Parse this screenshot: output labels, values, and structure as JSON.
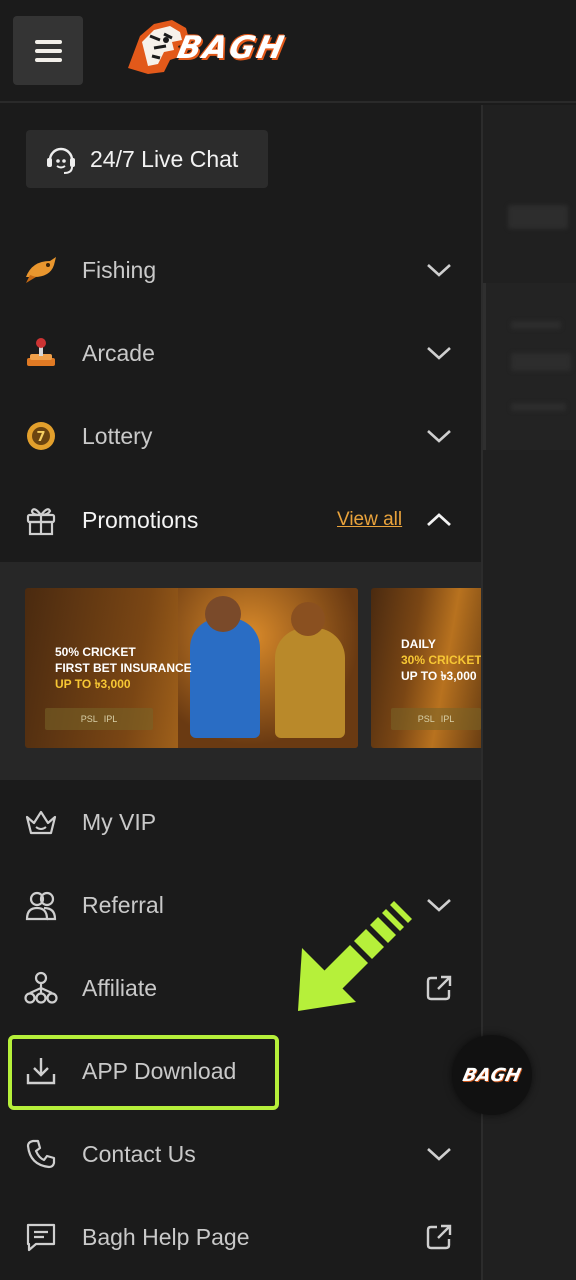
{
  "header": {
    "logo_text": "BAGH"
  },
  "live_chat": {
    "label": "24/7 Live Chat"
  },
  "menu": [
    {
      "id": "fishing",
      "label": "Fishing",
      "icon": "fishing-icon",
      "trailing": "chevron-down"
    },
    {
      "id": "arcade",
      "label": "Arcade",
      "icon": "arcade-icon",
      "trailing": "chevron-down"
    },
    {
      "id": "lottery",
      "label": "Lottery",
      "icon": "lottery-icon",
      "trailing": "chevron-down"
    },
    {
      "id": "promotions",
      "label": "Promotions",
      "icon": "gift-icon",
      "trailing": "chevron-up",
      "view_all": "View all"
    },
    {
      "id": "my-vip",
      "label": "My VIP",
      "icon": "crown-icon",
      "trailing": "none"
    },
    {
      "id": "referral",
      "label": "Referral",
      "icon": "users-icon",
      "trailing": "chevron-down"
    },
    {
      "id": "affiliate",
      "label": "Affiliate",
      "icon": "network-icon",
      "trailing": "external-link"
    },
    {
      "id": "app-download",
      "label": "APP Download",
      "icon": "download-icon",
      "trailing": "none"
    },
    {
      "id": "contact-us",
      "label": "Contact Us",
      "icon": "phone-icon",
      "trailing": "chevron-down"
    },
    {
      "id": "help-page",
      "label": "Bagh Help Page",
      "icon": "chat-icon",
      "trailing": "external-link"
    }
  ],
  "promotions": {
    "banners": [
      {
        "line1": "50% CRICKET",
        "line2": "FIRST BET INSURANCE",
        "line3": "UP TO ৳3,000"
      },
      {
        "line1": "DAILY",
        "line2": "30% CRICKET",
        "line3": "UP TO ৳3,000"
      }
    ],
    "banner_logo_labels": [
      "PSL",
      "IPL"
    ]
  },
  "fab": {
    "label": "BAGH"
  },
  "colors": {
    "background": "#1b1b1b",
    "accent_orange": "#e9a33c",
    "highlight_green": "#b6f03a",
    "text_primary": "#f2f2f2",
    "text_secondary": "#c9c9c9"
  }
}
